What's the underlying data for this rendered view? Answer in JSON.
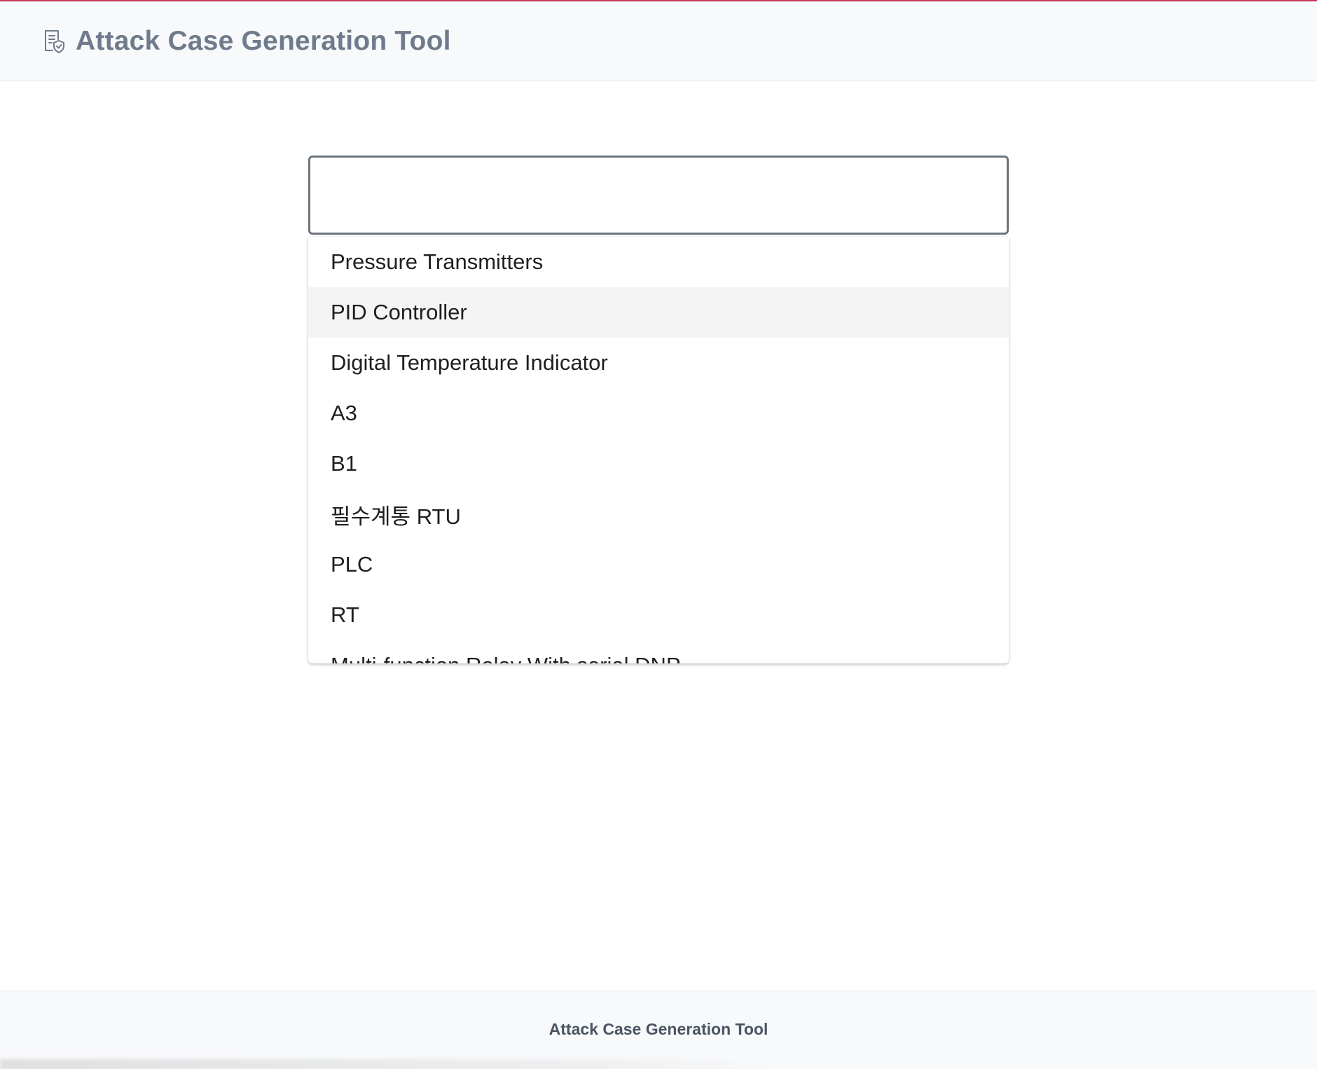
{
  "header": {
    "title": "Attack Case Generation Tool",
    "icon": "document-shield-icon"
  },
  "combobox": {
    "value": "",
    "placeholder": "",
    "options": [
      "Pressure Transmitters",
      "PID Controller",
      "Digital Temperature Indicator",
      "A3",
      "B1",
      "필수계통 RTU",
      "PLC",
      "RT",
      "Multi-function Relay With serial DNP"
    ],
    "highlighted_option": "PID Controller"
  },
  "footer": {
    "text": "Attack Case Generation Tool"
  },
  "colors": {
    "top_accent": "#c23a55",
    "header_bg": "#f8f9fa",
    "title_color": "#6f7b8c",
    "input_border": "#6c757d",
    "highlight_bg": "#f4f4f4"
  }
}
